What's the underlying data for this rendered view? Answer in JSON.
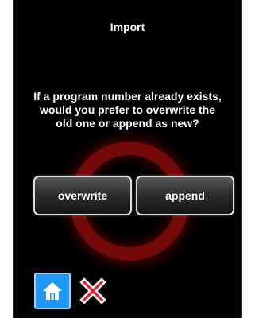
{
  "dialog": {
    "title": "Import",
    "message": "If a program number already exists, would you prefer to overwrite the old one or append as new?",
    "buttons": {
      "overwrite": "overwrite",
      "append": "append"
    }
  },
  "footer": {
    "home_icon": "home-icon",
    "close_icon": "close-icon"
  },
  "colors": {
    "background": "#000000",
    "accent_ring": "#7a0a0a",
    "home_button": "#2196f3",
    "close_icon": "#e8202a"
  }
}
